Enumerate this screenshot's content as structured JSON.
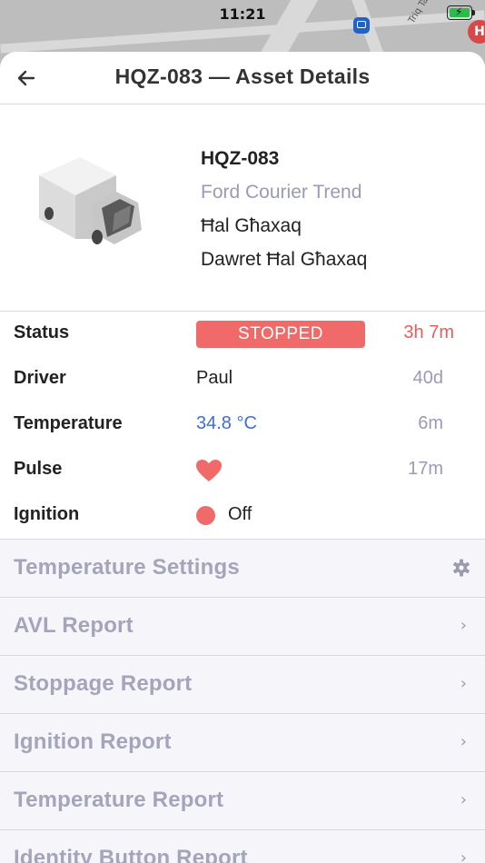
{
  "status_bar": {
    "time": "11:21",
    "map_label": "Triq Tal-Ħot",
    "pin_label": "H"
  },
  "nav": {
    "title": "HQZ-083 — Asset Details"
  },
  "asset": {
    "plate": "HQZ-083",
    "model": "Ford Courier Trend",
    "location": "Ħal Għaxaq",
    "area": "Dawret Ħal Għaxaq"
  },
  "details": [
    {
      "label": "Status",
      "value": "STOPPED",
      "age": "3h 7m"
    },
    {
      "label": "Driver",
      "value": "Paul",
      "age": "40d"
    },
    {
      "label": "Temperature",
      "value": "34.8 °C",
      "age": "6m"
    },
    {
      "label": "Pulse",
      "value": "",
      "age": "17m"
    },
    {
      "label": "Ignition",
      "value": "Off",
      "age": ""
    }
  ],
  "menu": [
    {
      "label": "Temperature Settings",
      "icon": "gear-icon"
    },
    {
      "label": "AVL Report",
      "icon": "chevron-right-icon"
    },
    {
      "label": "Stoppage Report",
      "icon": "chevron-right-icon"
    },
    {
      "label": "Ignition Report",
      "icon": "chevron-right-icon"
    },
    {
      "label": "Temperature Report",
      "icon": "chevron-right-icon"
    },
    {
      "label": "Identity Button Report",
      "icon": "chevron-right-icon"
    }
  ],
  "colors": {
    "stopped": "#f06a6a",
    "temperature": "#3a6fd8",
    "muted": "#9a9ab8",
    "battery": "#2bbd4a"
  }
}
